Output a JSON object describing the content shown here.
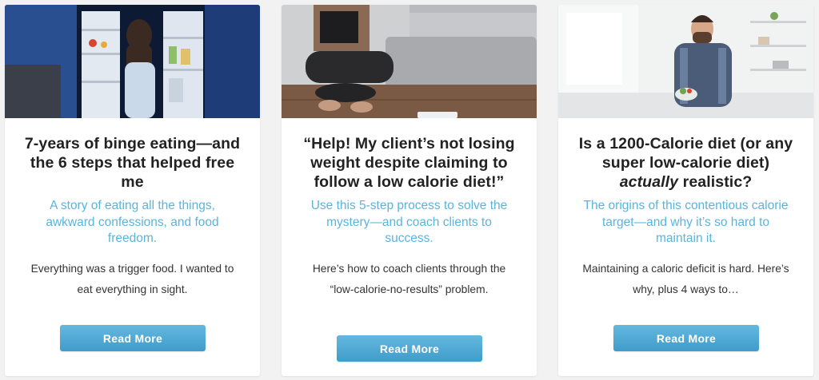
{
  "cards": [
    {
      "image": "woman-at-open-refrigerator-photo",
      "title": "7-years of binge eating—and the 6 steps that helped free me",
      "subtitle": "A story of eating all the things, awkward confessions, and food freedom.",
      "excerpt": "Everything was a trigger food. I wanted to eat everything in sight.",
      "button_label": "Read More"
    },
    {
      "image": "woman-sitting-on-floor-by-scale-photo",
      "title": "“Help! My client’s not losing weight despite claiming to follow a low calorie diet!”",
      "subtitle": "Use this 5-step process to solve the mystery—and coach clients to success.",
      "excerpt": "Here’s how to coach clients through the “low-calorie-no-results” problem.",
      "button_label": "Read More"
    },
    {
      "image": "man-eating-salad-photo",
      "title_prefix": "Is a 1200-Calorie diet (or any super low-calorie diet) ",
      "title_emphasis": "actually",
      "title_suffix": " realistic?",
      "subtitle": "The origins of this contentious calorie target—and why it’s so hard to maintain it.",
      "excerpt": "Maintaining a caloric deficit is hard. Here’s why, plus 4 ways to…",
      "button_label": "Read More"
    }
  ],
  "colors": {
    "accent_text": "#5ab4dc",
    "button": "#4aa7d3",
    "title": "#222222",
    "background": "#f2f2f2"
  }
}
